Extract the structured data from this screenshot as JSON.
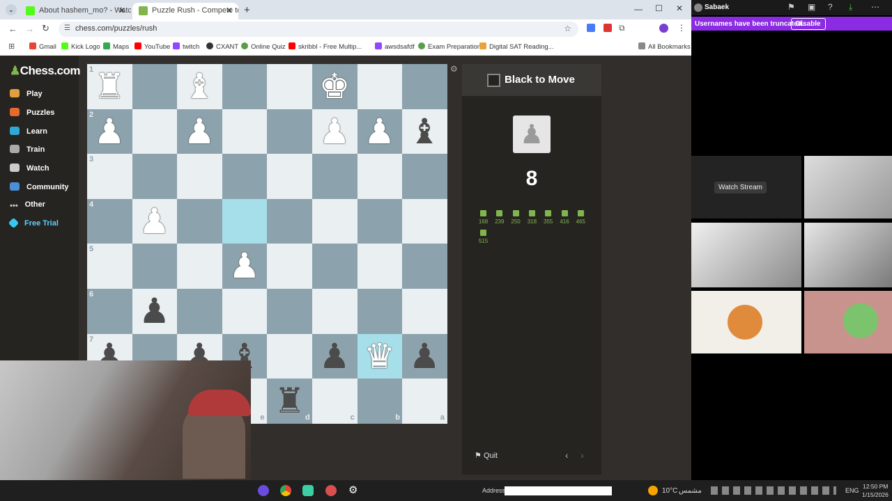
{
  "browser": {
    "tabs": [
      {
        "title": "About hashem_mo? - Watch Li",
        "active": false
      },
      {
        "title": "Puzzle Rush - Compete to Solv",
        "active": true
      }
    ],
    "url": "chess.com/puzzles/rush",
    "bookmarks": [
      "Gmail",
      "Kick Logo",
      "Maps",
      "YouTube",
      "twitch",
      "CXANT",
      "Online Quiz",
      "skribbl - Free Multip...",
      "awsdsafdf",
      "Exam Preparation",
      "Digital SAT Reading...",
      "All Bookmarks"
    ]
  },
  "site": {
    "logo": "Chess.com",
    "nav": [
      "Play",
      "Puzzles",
      "Learn",
      "Train",
      "Watch",
      "Community",
      "Other",
      "Free Trial"
    ]
  },
  "board": {
    "ranks": [
      "1",
      "2",
      "3",
      "4",
      "5",
      "6",
      "7"
    ],
    "files": [
      "e",
      "d",
      "c",
      "b",
      "a"
    ],
    "pieces": [
      {
        "glyph": "♜",
        "color": "w",
        "sq": [
          0,
          0
        ]
      },
      {
        "glyph": "♝",
        "color": "w",
        "sq": [
          2,
          0
        ]
      },
      {
        "glyph": "♚",
        "color": "w",
        "sq": [
          5,
          0
        ]
      },
      {
        "glyph": "♟",
        "color": "w",
        "sq": [
          0,
          1
        ]
      },
      {
        "glyph": "♟",
        "color": "w",
        "sq": [
          2,
          1
        ]
      },
      {
        "glyph": "♟",
        "color": "w",
        "sq": [
          5,
          1
        ]
      },
      {
        "glyph": "♟",
        "color": "w",
        "sq": [
          6,
          1
        ]
      },
      {
        "glyph": "♝",
        "color": "b",
        "sq": [
          7,
          1
        ]
      },
      {
        "glyph": "♟",
        "color": "w",
        "sq": [
          1,
          3
        ]
      },
      {
        "glyph": "♟",
        "color": "w",
        "sq": [
          3,
          4
        ]
      },
      {
        "glyph": "♟",
        "color": "b",
        "sq": [
          1,
          5
        ]
      },
      {
        "glyph": "♟",
        "color": "b",
        "sq": [
          0,
          6
        ]
      },
      {
        "glyph": "♟",
        "color": "b",
        "sq": [
          2,
          6
        ]
      },
      {
        "glyph": "♝",
        "color": "b",
        "sq": [
          3,
          6
        ]
      },
      {
        "glyph": "♟",
        "color": "b",
        "sq": [
          5,
          6
        ]
      },
      {
        "glyph": "♛",
        "color": "w",
        "sq": [
          6,
          6
        ]
      },
      {
        "glyph": "♟",
        "color": "b",
        "sq": [
          7,
          6
        ]
      },
      {
        "glyph": "♜",
        "color": "b",
        "sq": [
          4,
          7
        ]
      }
    ]
  },
  "panel": {
    "title": "Black to Move",
    "score": "8",
    "solved": [
      "168",
      "239",
      "250",
      "318",
      "355",
      "416",
      "465",
      "515"
    ],
    "quit": "Quit"
  },
  "stream": {
    "user": "Sabaek",
    "notice": "Usernames have been truncated.",
    "disable": "Disable",
    "watch": "Watch Stream"
  },
  "taskbar": {
    "address_label": "Address",
    "weather": "10°C",
    "weather_text": "مشمس",
    "lang": "ENG",
    "time": "12:50 PM",
    "date": "1/15/2026"
  }
}
